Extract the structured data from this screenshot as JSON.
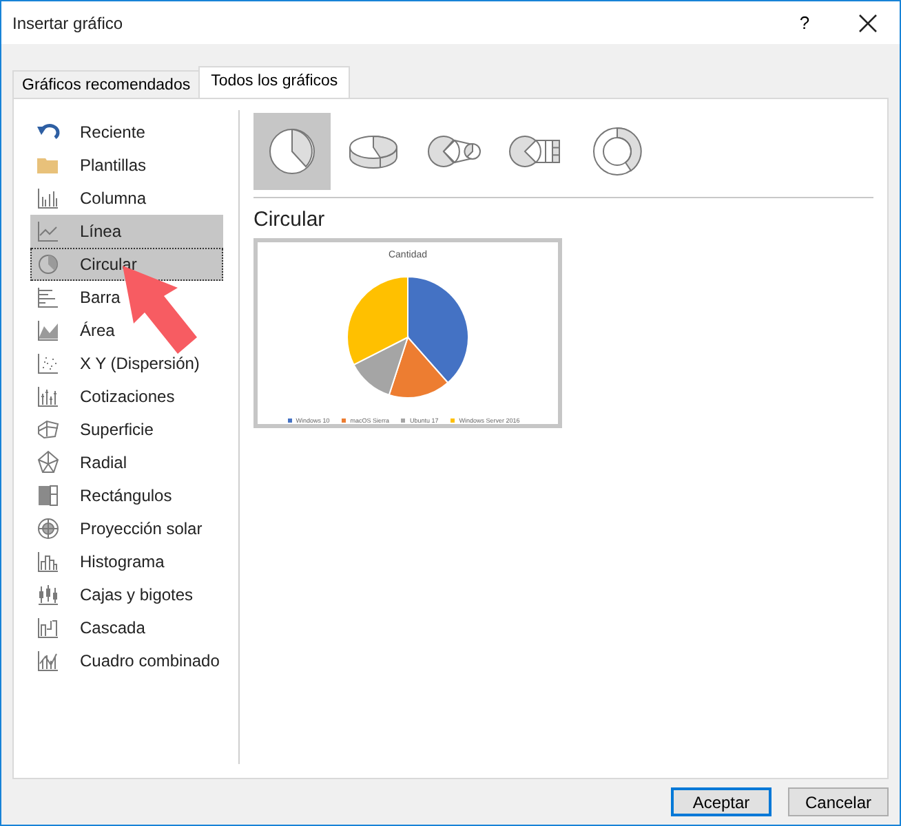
{
  "window": {
    "title": "Insertar gráfico",
    "help": "?"
  },
  "tabs": [
    {
      "label": "Gráficos recomendados",
      "selected": false
    },
    {
      "label": "Todos los gráficos",
      "selected": true
    }
  ],
  "sidebar": {
    "items": [
      {
        "label": "Reciente",
        "selected": false,
        "highlighted": false
      },
      {
        "label": "Plantillas",
        "selected": false,
        "highlighted": false
      },
      {
        "label": "Columna",
        "selected": false,
        "highlighted": false
      },
      {
        "label": "Línea",
        "selected": false,
        "highlighted": true
      },
      {
        "label": "Circular",
        "selected": true,
        "highlighted": true
      },
      {
        "label": "Barra",
        "selected": false,
        "highlighted": false
      },
      {
        "label": "Área",
        "selected": false,
        "highlighted": false
      },
      {
        "label": "X Y (Dispersión)",
        "selected": false,
        "highlighted": false
      },
      {
        "label": "Cotizaciones",
        "selected": false,
        "highlighted": false
      },
      {
        "label": "Superficie",
        "selected": false,
        "highlighted": false
      },
      {
        "label": "Radial",
        "selected": false,
        "highlighted": false
      },
      {
        "label": "Rectángulos",
        "selected": false,
        "highlighted": false
      },
      {
        "label": "Proyección solar",
        "selected": false,
        "highlighted": false
      },
      {
        "label": "Histograma",
        "selected": false,
        "highlighted": false
      },
      {
        "label": "Cajas y bigotes",
        "selected": false,
        "highlighted": false
      },
      {
        "label": "Cascada",
        "selected": false,
        "highlighted": false
      },
      {
        "label": "Cuadro combinado",
        "selected": false,
        "highlighted": false
      }
    ]
  },
  "subtypes": [
    {
      "selected": true
    },
    {
      "selected": false
    },
    {
      "selected": false
    },
    {
      "selected": false
    },
    {
      "selected": false
    }
  ],
  "heading": "Circular",
  "preview": {
    "title": "Cantidad",
    "legend": [
      {
        "label": "Windows 10",
        "color": "#4472c4"
      },
      {
        "label": "macOS Sierra",
        "color": "#ed7d31"
      },
      {
        "label": "Ubuntu 17",
        "color": "#a5a5a5"
      },
      {
        "label": "Windows Server 2016",
        "color": "#ffc000"
      }
    ]
  },
  "buttons": [
    {
      "label": "Aceptar",
      "selected": true
    },
    {
      "label": "Cancelar",
      "selected": false
    }
  ]
}
